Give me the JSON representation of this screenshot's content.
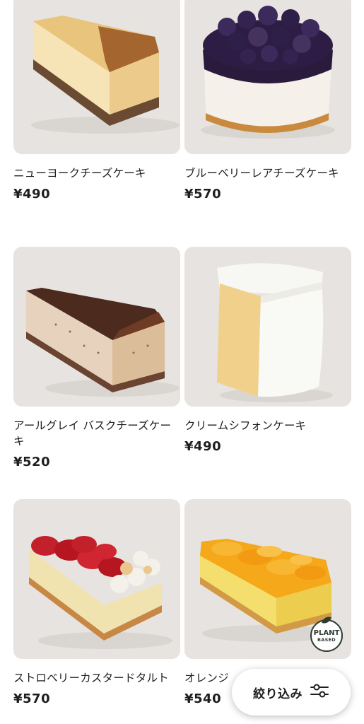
{
  "products": [
    {
      "name": "ニューヨークチーズケーキ",
      "price": "¥490",
      "image_icon": "new-york-cheesecake-image"
    },
    {
      "name": "ブルーベリーレアチーズケーキ",
      "price": "¥570",
      "image_icon": "blueberry-rare-cheesecake-image"
    },
    {
      "name": "アールグレイ バスクチーズケーキ",
      "price": "¥520",
      "image_icon": "earl-grey-basque-cheesecake-image"
    },
    {
      "name": "クリームシフォンケーキ",
      "price": "¥490",
      "image_icon": "cream-chiffon-cake-image"
    },
    {
      "name": "ストロベリーカスタードタルト",
      "price": "¥570",
      "image_icon": "strawberry-custard-tart-image"
    },
    {
      "name": "オレンジ",
      "price": "¥540",
      "image_icon": "orange-cake-image"
    }
  ],
  "badge": {
    "line1": "PLANT",
    "line2": "BASED",
    "icon": "leaf-icon"
  },
  "filter_button": {
    "label": "絞り込み",
    "icon": "filter-sliders-icon"
  },
  "colors": {
    "card_background": "#e6e3e0",
    "text": "#1e1e1e",
    "badge": "#2e3b33"
  }
}
